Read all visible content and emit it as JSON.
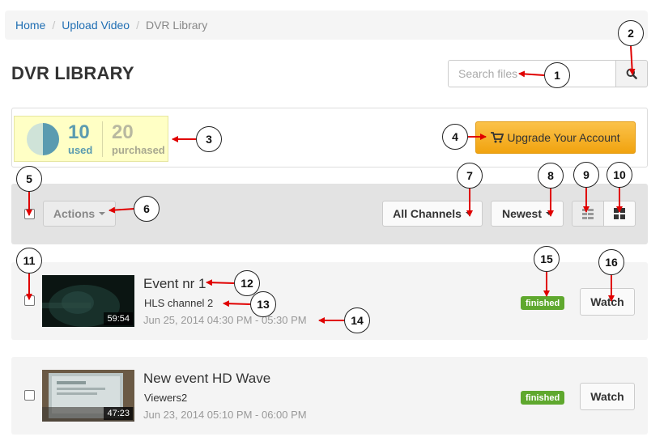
{
  "breadcrumb": {
    "home": "Home",
    "upload": "Upload Video",
    "current": "DVR Library",
    "separator": "/"
  },
  "page": {
    "title": "DVR LIBRARY"
  },
  "search": {
    "placeholder": "Search files",
    "icon": "search-icon"
  },
  "usage": {
    "used_count": "10",
    "used_label": "used",
    "purchased_count": "20",
    "purchased_label": "purchased",
    "pie_icon": "usage-pie-icon"
  },
  "upgrade": {
    "label": "Upgrade Your Account",
    "icon": "cart-icon"
  },
  "toolbar": {
    "actions_label": "Actions",
    "channels_label": "All Channels",
    "sort_label": "Newest",
    "list_view_icon": "list-view-icon",
    "grid_view_icon": "grid-view-icon"
  },
  "events": [
    {
      "title": "Event nr 1",
      "channel": "HLS channel 2",
      "time": "Jun 25, 2014 04:30 PM - 05:30 PM",
      "duration": "59:54",
      "status": "finished",
      "action": "Watch"
    },
    {
      "title": "New event HD Wave",
      "channel": "Viewers2",
      "time": "Jun 23, 2014 05:10 PM - 06:00 PM",
      "duration": "47:23",
      "status": "finished",
      "action": "Watch"
    }
  ],
  "annotations": [
    "1",
    "2",
    "3",
    "4",
    "5",
    "6",
    "7",
    "8",
    "9",
    "10",
    "11",
    "12",
    "13",
    "14",
    "15",
    "16"
  ],
  "colors": {
    "link": "#1f6eb3",
    "annotation_arrow": "#e00000",
    "upgrade_button": "#f1a30f",
    "status_finished": "#5fa82e",
    "usage_box": "#ffffc5",
    "used_text": "#5b9bb0"
  }
}
